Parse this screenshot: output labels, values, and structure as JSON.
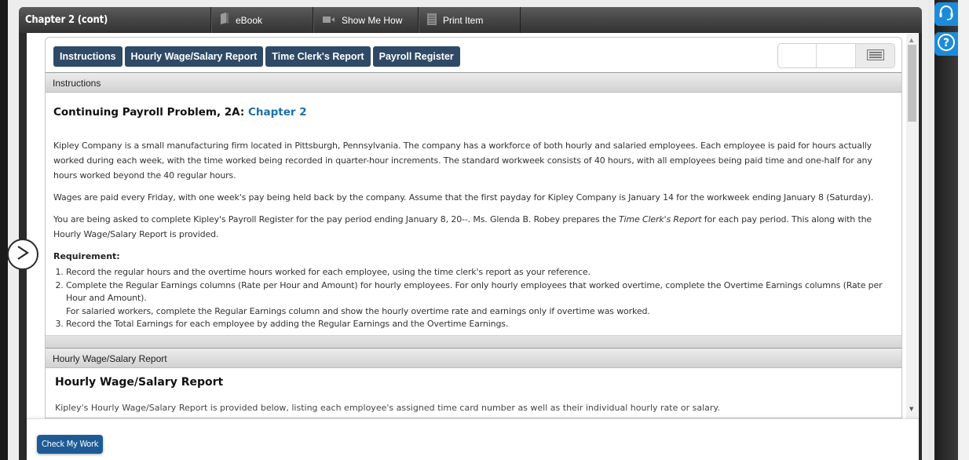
{
  "window": {
    "title": "Chapter 2 (cont)",
    "toolbar": [
      {
        "label": "eBook",
        "icon": "book-icon"
      },
      {
        "label": "Show Me How",
        "icon": "video-icon"
      },
      {
        "label": "Print Item",
        "icon": "print-icon"
      }
    ]
  },
  "tabs": [
    {
      "label": "Instructions"
    },
    {
      "label": "Hourly Wage/Salary Report"
    },
    {
      "label": "Time Clerk's Report"
    },
    {
      "label": "Payroll Register"
    }
  ],
  "instructions": {
    "section_label": "Instructions",
    "heading_prefix": "Continuing Payroll Problem, 2A:",
    "heading_link": "Chapter 2",
    "para1": "Kipley Company is a small manufacturing firm located in Pittsburgh, Pennsylvania. The company has a workforce of both hourly and salaried employees. Each employee is paid for hours actually worked during each week, with the time worked being recorded in quarter-hour increments. The standard workweek consists of 40 hours, with all employees being paid time and one-half for any hours worked beyond the 40 regular hours.",
    "para2": "Wages are paid every Friday, with one week's pay being held back by the company. Assume that the first payday for Kipley Company is January 14 for the workweek ending January 8 (Saturday).",
    "para3_before": "You are being asked to complete Kipley's Payroll Register for the pay period ending January 8, 20--. Ms. Glenda B. Robey prepares the ",
    "para3_italic": "Time Clerk's Report",
    "para3_after": " for each pay period. This along with the Hourly Wage/Salary Report is provided.",
    "requirement_label": "Requirement:",
    "requirements": [
      "Record the regular hours and the overtime hours worked for each employee, using the time clerk's report as your reference.",
      "Complete the Regular Earnings columns (Rate per Hour and Amount) for hourly employees. For only hourly employees that worked overtime, complete the Overtime Earnings columns (Rate per Hour and Amount).",
      "For salaried workers, complete the Regular Earnings column and show the hourly overtime rate and earnings only if overtime was worked.",
      "Record the Total Earnings for each employee by adding the Regular Earnings and the Overtime Earnings."
    ]
  },
  "wage_report": {
    "section_label": "Hourly Wage/Salary Report",
    "heading": "Hourly Wage/Salary Report",
    "intro": "Kipley's Hourly Wage/Salary Report is provided below, listing each employee's assigned time card number as well as their individual hourly rate or salary."
  },
  "footer": {
    "check_button": "Check My Work"
  },
  "colors": {
    "tab_bg": "#2e4a66",
    "link": "#1f6fa8",
    "check_button_bg": "#1d5b96",
    "side_button_bg": "#1d8bd8"
  }
}
